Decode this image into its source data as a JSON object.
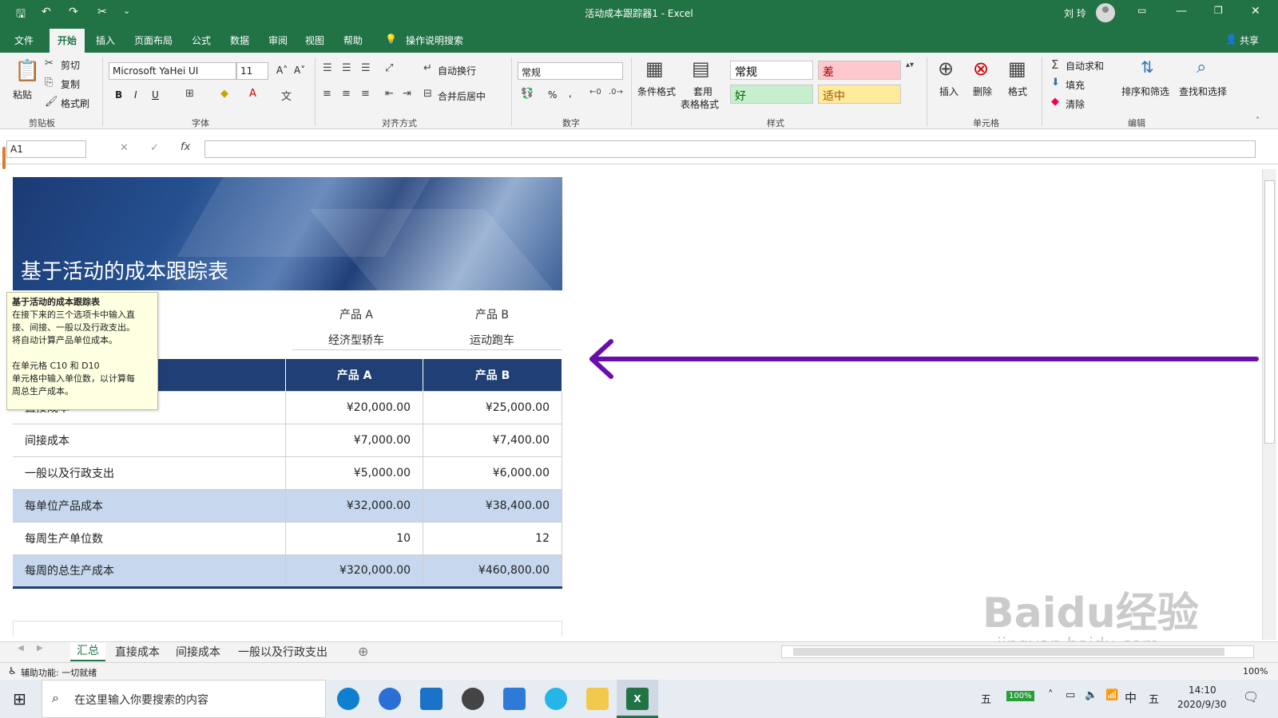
{
  "window": {
    "title": "活动成本跟踪器1 - Excel",
    "user": "刘 玲",
    "share": "共享"
  },
  "quick_access": {
    "save": "🖫",
    "undo": "↶",
    "redo": "↷",
    "cut": "✂",
    "more": "⌄"
  },
  "menu": {
    "items": [
      "文件",
      "开始",
      "插入",
      "页面布局",
      "公式",
      "数据",
      "审阅",
      "视图",
      "帮助"
    ],
    "tell_me": "操作说明搜索"
  },
  "ribbon": {
    "clipboard": {
      "paste": "粘贴",
      "cut": "剪切",
      "copy": "复制",
      "format_painter": "格式刷",
      "label": "剪贴板"
    },
    "font": {
      "name": "Microsoft YaHei UI",
      "size": "11",
      "bold": "B",
      "italic": "I",
      "underline": "U",
      "label": "字体"
    },
    "alignment": {
      "wrap": "自动换行",
      "merge": "合并后居中",
      "label": "对齐方式"
    },
    "number": {
      "format": "常规",
      "percent": "%",
      "comma": ",",
      "label": "数字"
    },
    "styles": {
      "conditional": "条件格式",
      "table_line1": "套用",
      "table_line2": "表格格式",
      "normal": "常规",
      "bad": "差",
      "good": "好",
      "neutral": "适中",
      "label": "样式"
    },
    "cells": {
      "insert": "插入",
      "delete": "删除",
      "format": "格式",
      "label": "单元格"
    },
    "editing": {
      "autosum": "自动求和",
      "fill": "填充",
      "clear": "清除",
      "sort": "排序和筛选",
      "find": "查找和选择",
      "label": "编辑"
    }
  },
  "formula_bar": {
    "name_box": "A1",
    "fx": "fx",
    "cancel": "✕",
    "enter": "✓",
    "value": ""
  },
  "sheet": {
    "banner_title": "基于活动的成本跟踪表",
    "products": [
      {
        "name": "产品 A",
        "desc": "经济型轿车"
      },
      {
        "name": "产品 B",
        "desc": "运动跑车"
      }
    ],
    "table": {
      "headers": [
        "",
        "产品 A",
        "产品 B"
      ],
      "rows": [
        {
          "label": "直接成本",
          "a": "¥20,000.00",
          "b": "¥25,000.00"
        },
        {
          "label": "间接成本",
          "a": "¥7,000.00",
          "b": "¥7,400.00"
        },
        {
          "label": "一般以及行政支出",
          "a": "¥5,000.00",
          "b": "¥6,000.00"
        },
        {
          "label": "每单位产品成本",
          "a": "¥32,000.00",
          "b": "¥38,400.00"
        },
        {
          "label": "每周生产单位数",
          "a": "10",
          "b": "12"
        },
        {
          "label": "每周的总生产成本",
          "a": "¥320,000.00",
          "b": "¥460,800.00"
        }
      ]
    },
    "tooltip": {
      "title": "基于活动的成本跟踪表",
      "line1": "在接下来的三个选项卡中输入直",
      "line2": "接、间接、一般以及行政支出。",
      "line3": "将自动计算产品单位成本。",
      "line4": "在单元格 C10 和 D10",
      "line5": "单元格中输入单位数，以计算每",
      "line6": "周总生产成本。"
    },
    "arrow_color": "#6a0dad"
  },
  "sheet_tabs": [
    "汇总",
    "直接成本",
    "间接成本",
    "一般以及行政支出"
  ],
  "status": {
    "text": "辅助功能: 一切就绪",
    "zoom": "100%"
  },
  "taskbar": {
    "search_placeholder": "在这里输入你要搜索的内容",
    "time": "14:10",
    "date": "2020/9/30",
    "ime": "中",
    "ime2": "五",
    "battery": "100%"
  },
  "watermark": {
    "text": "Baidu经验",
    "sub": "jingyan.baidu.com"
  }
}
